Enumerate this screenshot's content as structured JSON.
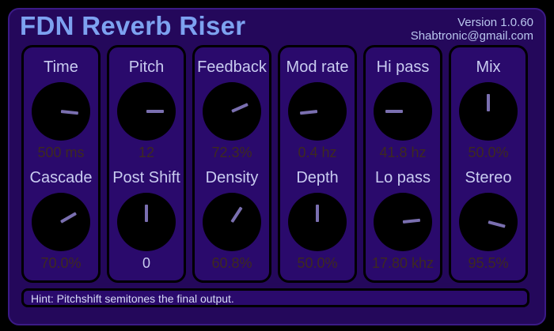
{
  "plugin": {
    "title": "FDN Reverb Riser",
    "version": "Version 1.0.60",
    "email": "Shabtronic@gmail.com"
  },
  "colors": {
    "frame": "#24085b",
    "panel": "#2a0a6c",
    "title": "#7da2f0",
    "label": "#c9ccf0",
    "value_dim": "#3e2a1f",
    "knob": "#000000",
    "pointer": "#7a6fb0"
  },
  "columns": [
    {
      "top": {
        "label": "Time",
        "value": "500 ms",
        "level": 0.82
      },
      "bottom": {
        "label": "Cascade",
        "value": "70.0%",
        "level": 0.7
      }
    },
    {
      "top": {
        "label": "Pitch",
        "value": "12",
        "level": 0.8
      },
      "bottom": {
        "label": "Post Shift",
        "value": "0",
        "level": 0.5
      }
    },
    {
      "top": {
        "label": "Feedback",
        "value": "72.3%",
        "level": 0.72
      },
      "bottom": {
        "label": "Density",
        "value": "60.8%",
        "level": 0.61
      }
    },
    {
      "top": {
        "label": "Mod rate",
        "value": "0.4 hz",
        "level": 0.18
      },
      "bottom": {
        "label": "Depth",
        "value": "50.0%",
        "level": 0.5
      }
    },
    {
      "top": {
        "label": "Hi pass",
        "value": "41.8 hz",
        "level": 0.2
      },
      "bottom": {
        "label": "Lo pass",
        "value": "17.80 khz",
        "level": 0.78
      }
    },
    {
      "top": {
        "label": "Mix",
        "value": "50.0%",
        "level": 0.5
      },
      "bottom": {
        "label": "Stereo",
        "value": "95.5%",
        "level": 0.85
      }
    }
  ],
  "hint": "Hint: Pitchshift semitones the final output."
}
